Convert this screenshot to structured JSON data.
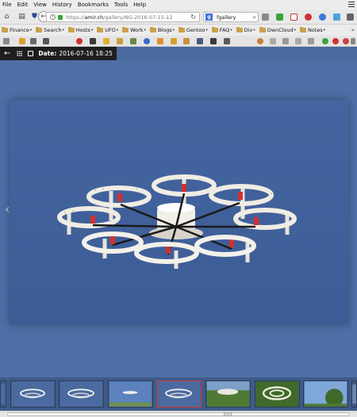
{
  "menu": [
    "File",
    "Edit",
    "View",
    "History",
    "Bookmarks",
    "Tools",
    "Help"
  ],
  "menu_underline": [
    "F",
    "E",
    "V",
    "H",
    "B",
    "T",
    "H"
  ],
  "address": {
    "prefix": "https://",
    "host": "amir.ch",
    "path": "/gallery/NG-2016-07-15-12"
  },
  "search": {
    "engine_icon": "google-icon",
    "query": "fgallery"
  },
  "bookmarks": [
    "Finance",
    "Search",
    "Hosts",
    "UFO",
    "Work",
    "Blogs",
    "Gentoo",
    "FAQ",
    "Div",
    "OwnCloud",
    "Notes"
  ],
  "gallery": {
    "date_label": "Date:",
    "date_value": "2016-07-16 18:25",
    "photo_subject": "hexacopter-drone",
    "thumbnails": [
      "drone-thumb",
      "drone-thumb",
      "drone-thumb",
      "sky-thumb",
      "drone-thumb",
      "trees-thumb",
      "drone-ground-thumb",
      "tree-thumb",
      "partial-thumb"
    ],
    "selected_thumbnail": 4
  },
  "colors": {
    "sky": "#4e6fa6",
    "accent_selected": "#d23a3a",
    "header_bg": "#1e1e1e"
  }
}
